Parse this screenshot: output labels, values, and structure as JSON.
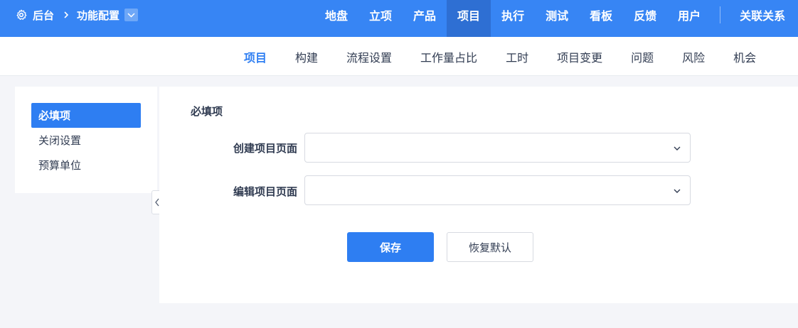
{
  "header": {
    "breadcrumb": {
      "home_label": "后台",
      "current_label": "功能配置"
    },
    "nav": [
      {
        "label": "地盘",
        "active": false
      },
      {
        "label": "立项",
        "active": false
      },
      {
        "label": "产品",
        "active": false
      },
      {
        "label": "项目",
        "active": true
      },
      {
        "label": "执行",
        "active": false
      },
      {
        "label": "测试",
        "active": false
      },
      {
        "label": "看板",
        "active": false
      },
      {
        "label": "反馈",
        "active": false
      },
      {
        "label": "用户",
        "active": false
      }
    ],
    "nav_extra_label": "关联关系",
    "colors": {
      "bar": "#3785f4",
      "active": "#2e6fd3"
    }
  },
  "subnav": [
    {
      "label": "项目",
      "active": true
    },
    {
      "label": "构建",
      "active": false
    },
    {
      "label": "流程设置",
      "active": false
    },
    {
      "label": "工作量占比",
      "active": false
    },
    {
      "label": "工时",
      "active": false
    },
    {
      "label": "项目变更",
      "active": false
    },
    {
      "label": "问题",
      "active": false
    },
    {
      "label": "风险",
      "active": false
    },
    {
      "label": "机会",
      "active": false
    }
  ],
  "sidebar": {
    "items": [
      {
        "label": "必填项",
        "active": true
      },
      {
        "label": "关闭设置",
        "active": false
      },
      {
        "label": "预算单位",
        "active": false
      }
    ]
  },
  "form": {
    "title": "必填项",
    "fields": [
      {
        "label": "创建项目页面",
        "value": ""
      },
      {
        "label": "编辑项目页面",
        "value": ""
      }
    ],
    "save_label": "保存",
    "reset_label": "恢复默认"
  },
  "icons": {
    "breadcrumb_home": "gear-icon",
    "breadcrumb_separator": "chevron-right-icon",
    "breadcrumb_dropdown": "chevron-down-icon",
    "select_arrow": "chevron-down-icon",
    "sidebar_collapse": "chevron-left-icon"
  },
  "accent_color": "#2e7ef2"
}
